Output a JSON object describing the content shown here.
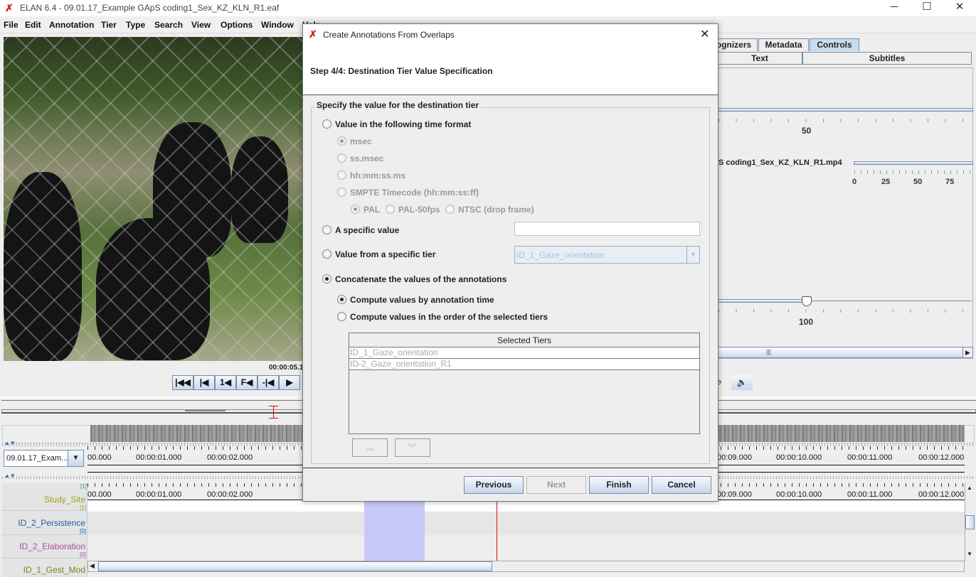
{
  "window": {
    "title": "ELAN 6.4 - 09.01.17_Example GApS coding1_Sex_KZ_KLN_R1.eaf",
    "minimize": "─",
    "maximize": "☐",
    "close": "✕"
  },
  "menu": [
    "File",
    "Edit",
    "Annotation",
    "Tier",
    "Type",
    "Search",
    "View",
    "Options",
    "Window",
    "Help"
  ],
  "player": {
    "time": "00:00:05.1",
    "buttons": [
      "|◀◀",
      "|◀",
      "1◀",
      "F◀",
      "-|◀",
      "▶"
    ]
  },
  "right_panel": {
    "tabs": [
      "ognizers",
      "Metadata",
      "Controls"
    ],
    "active_tab": "Controls",
    "subtabs": [
      "Text",
      "Subtitles"
    ],
    "rate_label": "50",
    "media_file": "S coding1_Sex_KZ_KLN_R1.mp4",
    "volume_scale": [
      "0",
      "25",
      "50",
      "75"
    ],
    "zoom_label": "100",
    "cut_label": "e"
  },
  "timeline": {
    "tier_combo": "09.01.17_Exam...",
    "ruler_left": [
      "00.000",
      "00:00:01.000",
      "00:00:02.000",
      "00:00:0"
    ],
    "ruler_right": [
      "00:09.000",
      "00:00:10.000",
      "00:00:11.000",
      "00:00:12.000"
    ],
    "tiers": [
      {
        "name": "Study_Site",
        "count": "[1]",
        "color": "#a0a020"
      },
      {
        "name": "ID_2_Persistence",
        "count": "[0]",
        "color": "#2060a0"
      },
      {
        "name": "ID_2_Elaboration",
        "count": "[0]",
        "color": "#a050a8"
      },
      {
        "name": "ID_1_Gest_Mod",
        "count": "",
        "color": "#808020"
      }
    ],
    "top_count": "[1]"
  },
  "dialog": {
    "title": "Create Annotations From Overlaps",
    "close": "✕",
    "step": "Step 4/4: Destination Tier Value Specification",
    "group_title": "Specify the value for the destination tier",
    "opt_time_format": "Value in the following time format",
    "time_formats": [
      "msec",
      "ss.msec",
      "hh:mm:ss.ms",
      "SMPTE Timecode (hh:mm:ss:ff)"
    ],
    "smpte": [
      "PAL",
      "PAL-50fps",
      "NTSC (drop frame)"
    ],
    "opt_specific_value": "A specific value",
    "specific_value": "",
    "opt_from_tier": "Value from a specific tier",
    "from_tier_selected": "ID_1_Gaze_orientation",
    "opt_concat": "Concatenate the values of the annotations",
    "concat_by_time": "Compute values by annotation time",
    "concat_by_order": "Compute values in the order of the selected tiers",
    "table_header": "Selected Tiers",
    "table_rows": [
      "ID_1_Gaze_orientation",
      "ID-2_Gaze_orientation_R1"
    ],
    "up": "︽",
    "down": "︾",
    "buttons": {
      "previous": "Previous",
      "next": "Next",
      "finish": "Finish",
      "cancel": "Cancel"
    }
  },
  "colors": {
    "accent": "#c8d8ec",
    "selection": "#c8c8f8",
    "crosshair": "#d01010"
  }
}
